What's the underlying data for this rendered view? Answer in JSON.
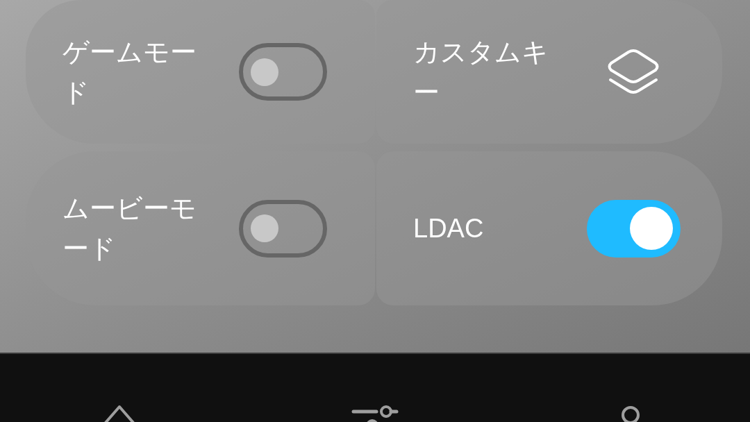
{
  "settings": [
    {
      "label": "ゲームモード",
      "kind": "toggle",
      "on": false
    },
    {
      "label": "カスタムキー",
      "kind": "layers"
    },
    {
      "label": "ムービーモード",
      "kind": "toggle",
      "on": false
    },
    {
      "label": "LDAC",
      "kind": "toggle",
      "on": true
    }
  ],
  "nav_bar": {
    "items": [
      {
        "kind": "home"
      },
      {
        "kind": "sliders"
      },
      {
        "kind": "person"
      }
    ]
  }
}
